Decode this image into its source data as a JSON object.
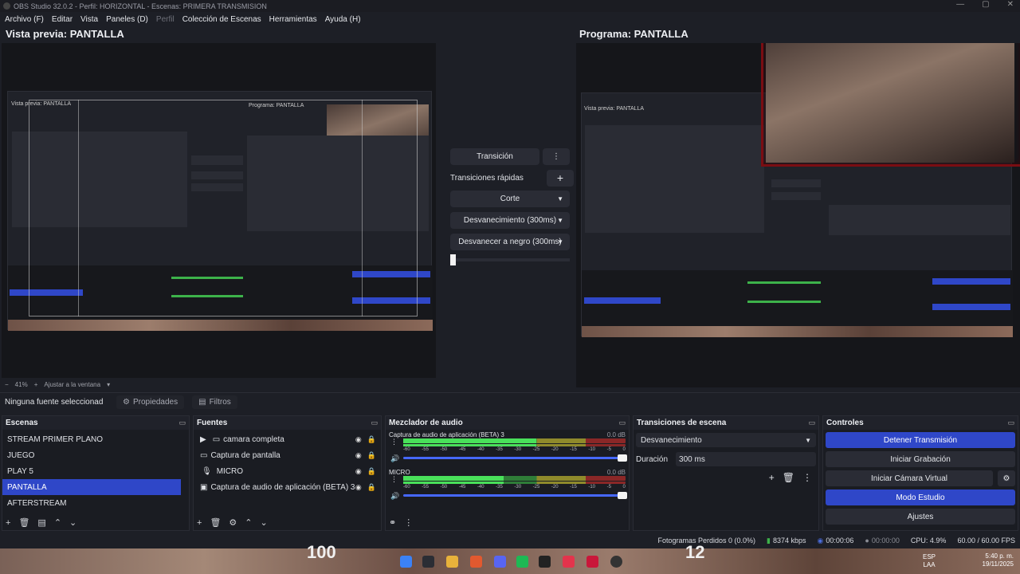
{
  "window": {
    "title": "OBS Studio 32.0.2 - Perfil: HORIZONTAL - Escenas: PRIMERA TRANSMISION",
    "controls": [
      "—",
      "▢",
      "✕"
    ]
  },
  "menu": [
    "Archivo (F)",
    "Editar",
    "Vista",
    "Paneles (D)",
    "Perfil",
    "Colección de Escenas",
    "Herramientas",
    "Ayuda (H)"
  ],
  "preview": {
    "label": "Vista previa: PANTALLA",
    "zoom": "41%",
    "fit_label": "Ajustar a la ventana"
  },
  "program": {
    "label": "Programa: PANTALLA"
  },
  "nested": {
    "preview_label": "Vista previa: PANTALLA",
    "program_label": "Programa: PANTALLA"
  },
  "transitions_panel": {
    "transition_button": "Transición",
    "quick_label": "Transiciones rápidas",
    "items": [
      "Corte",
      "Desvanecimiento (300ms)",
      "Desvanecer a negro (300ms)"
    ]
  },
  "properties_bar": {
    "no_source": "Ninguna fuente seleccionad",
    "properties": "Propiedades",
    "filters": "Filtros"
  },
  "scenes": {
    "title": "Escenas",
    "items": [
      "STREAM PRIMER PLANO",
      "JUEGO",
      "PLAY 5",
      "PANTALLA",
      "AFTERSTREAM"
    ],
    "selected_index": 3
  },
  "sources": {
    "title": "Fuentes",
    "items": [
      {
        "label": "camara completa",
        "icon": "folder-icon"
      },
      {
        "label": "Captura de pantalla",
        "icon": "monitor-icon"
      },
      {
        "label": "MICRO",
        "icon": "mic-icon"
      },
      {
        "label": "Captura de audio de aplicación (BETA) 3",
        "icon": "app-audio-icon"
      }
    ]
  },
  "mixer": {
    "title": "Mezclador de audio",
    "channels": [
      {
        "name": "Captura de audio de aplicación (BETA) 3",
        "db": "0.0 dB",
        "level": 0.6
      },
      {
        "name": "MICRO",
        "db": "0.0 dB",
        "level": 0.45
      }
    ],
    "ticks": [
      "-60",
      "-55",
      "-50",
      "-45",
      "-40",
      "-35",
      "-30",
      "-25",
      "-20",
      "-15",
      "-10",
      "-5",
      "0"
    ]
  },
  "scene_transitions": {
    "title": "Transiciones de escena",
    "selected": "Desvanecimiento",
    "duration_label": "Duración",
    "duration_value": "300 ms"
  },
  "controls": {
    "title": "Controles",
    "buttons": [
      "Detener Transmisión",
      "Iniciar Grabación",
      "Iniciar Cámara Virtual",
      "Modo Estudio",
      "Ajustes"
    ]
  },
  "status": {
    "dropped": "Fotogramas Perdidos 0 (0.0%)",
    "bitrate": "8374 kbps",
    "stream_time": "00:00:06",
    "rec_time": "00:00:00",
    "cpu": "CPU: 4.9%",
    "fps": "60.00 / 60.00 FPS"
  },
  "taskbar": {
    "lang": "ESP",
    "lang2": "LAA",
    "time": "5:40 p. m.",
    "date": "19/11/2025"
  },
  "overlay": {
    "score_left": "100",
    "score_right": "12"
  },
  "colors": {
    "accent": "#2f47c8",
    "meter_green": "#49e05a",
    "frame_red": "#7a0d12"
  }
}
